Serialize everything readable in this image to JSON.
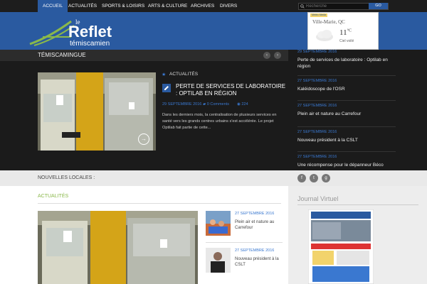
{
  "nav": {
    "items": [
      "ACCUEIL",
      "ACTUALITÉS",
      "SPORTS & LOISIRS",
      "ARTS & CULTURE",
      "ARCHIVES",
      "DIVERS"
    ],
    "search_placeholder": "Recherche",
    "go_label": "GO"
  },
  "header": {
    "logo_word": "Reflet",
    "logo_prefix": "le",
    "logo_sub": "témiscamien"
  },
  "weather": {
    "badge": "Météo Media",
    "city": "Ville-Marie, QC",
    "temp": "11",
    "unit": "°C",
    "condition": "Ciel voilé"
  },
  "featured": {
    "section_title": "TÉMISCAMINGUE",
    "prev_label": "‹",
    "next_label": "›",
    "category": "ACTUALITÉS",
    "headline": "PERTE DE SERVICES DE LABORATOIRE : OPTILAB EN RÉGION",
    "date": "29 SEPTEMBRE 2016",
    "comments": "0 Comments",
    "views": "224",
    "excerpt": "Dans les derniers mois, la centralisation de plusieurs services en santé vers les grands centres urbains s'est accélérée. Le projet Optilab fait partie de cette..."
  },
  "side_list": [
    {
      "date": "29 SEPTEMBRE 2016",
      "title": "Perte de services de laboratoire : Optilab en région"
    },
    {
      "date": "27 SEPTEMBRE 2016",
      "title": "Kaléidoscope de l'OSR"
    },
    {
      "date": "27 SEPTEMBRE 2016",
      "title": "Plein air et nature au Carrefour"
    },
    {
      "date": "27 SEPTEMBRE 2016",
      "title": "Nouveau président à la CSLT"
    },
    {
      "date": "27 SEPTEMBRE 2016",
      "title": "Une récompense pour le dépanneur Béco"
    }
  ],
  "local": {
    "label": "NOUVELLES LOCALES :"
  },
  "main": {
    "section_title": "ACTUALITÉS",
    "list": [
      {
        "date": "27 SEPTEMBRE 2016",
        "title": "Plein air et nature au Carrefour"
      },
      {
        "date": "27 SEPTEMBRE 2016",
        "title": "Nouveau président à la CSLT"
      }
    ]
  },
  "right": {
    "title": "Journal Virtuel"
  },
  "colors": {
    "brand_blue": "#2a5aa0",
    "accent_green": "#8ab84a",
    "dark_bg": "#1b1b1b"
  }
}
